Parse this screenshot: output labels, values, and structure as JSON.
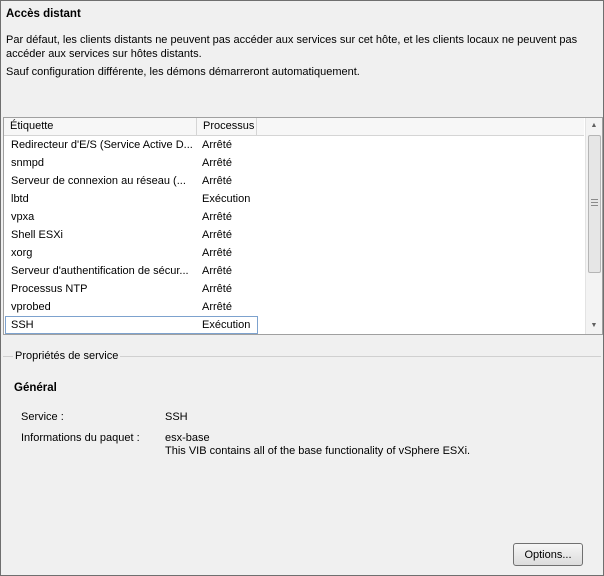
{
  "title": "Accès distant",
  "description": "Par défaut, les clients distants ne peuvent pas accéder aux services sur cet hôte, et les clients locaux ne peuvent pas accéder aux services sur hôtes distants.",
  "auto_start_note": "Sauf configuration différente, les démons démarreront automatiquement.",
  "table": {
    "columns": [
      "Étiquette",
      "Processus"
    ],
    "rows": [
      {
        "label": "Redirecteur d'E/S (Service Active D...",
        "status": "Arrêté"
      },
      {
        "label": "snmpd",
        "status": "Arrêté"
      },
      {
        "label": "Serveur de connexion au réseau (...",
        "status": "Arrêté"
      },
      {
        "label": "lbtd",
        "status": "Exécution"
      },
      {
        "label": "vpxa",
        "status": "Arrêté"
      },
      {
        "label": "Shell ESXi",
        "status": "Arrêté"
      },
      {
        "label": "xorg",
        "status": "Arrêté"
      },
      {
        "label": "Serveur d'authentification de sécur...",
        "status": "Arrêté"
      },
      {
        "label": "Processus NTP",
        "status": "Arrêté"
      },
      {
        "label": "vprobed",
        "status": "Arrêté"
      },
      {
        "label": "SSH",
        "status": "Exécution",
        "selected": true
      }
    ]
  },
  "properties": {
    "legend": "Propriétés de service",
    "section": "Général",
    "service_label": "Service :",
    "service_value": "SSH",
    "package_label": "Informations du paquet :",
    "package_name": "esx-base",
    "package_desc": "This VIB contains all of the base functionality of vSphere ESXi."
  },
  "options_button": "Options..."
}
